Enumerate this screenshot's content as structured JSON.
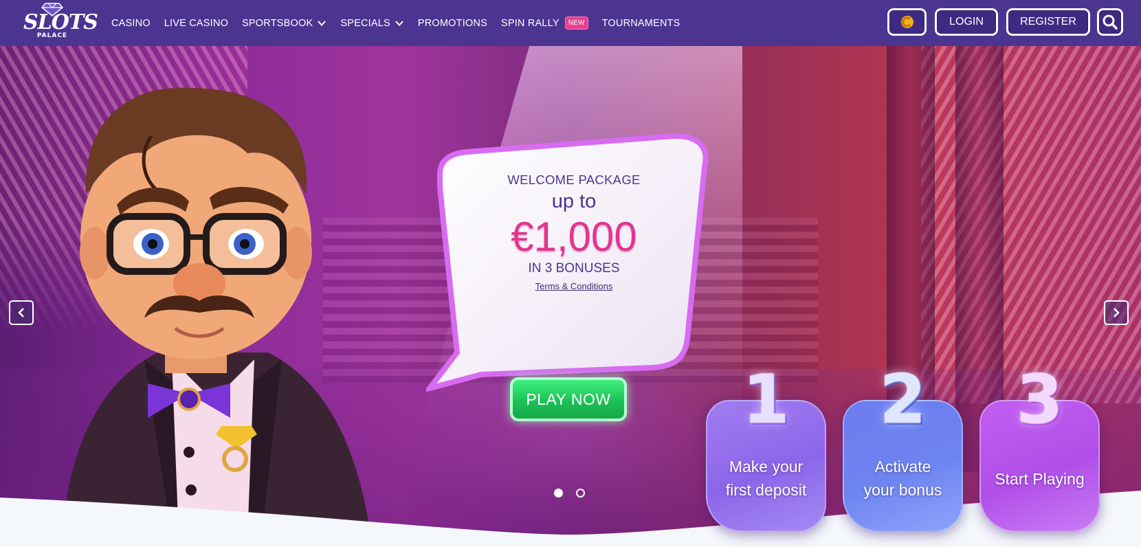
{
  "header": {
    "logo": {
      "brand": "SLOTS",
      "sub": "PALACE"
    },
    "nav": [
      {
        "label": "CASINO"
      },
      {
        "label": "LIVE CASINO"
      },
      {
        "label": "SPORTSBOOK"
      },
      {
        "label": "SPECIALS"
      },
      {
        "label": "PROMOTIONS"
      },
      {
        "label": "SPIN RALLY",
        "badge": "NEW"
      },
      {
        "label": "TOURNAMENTS"
      }
    ],
    "buttons": {
      "login": "LOGIN",
      "register": "REGISTER"
    },
    "icons": {
      "coin": "coin-icon",
      "search": "search-icon",
      "dropdown": "chevron-down-icon"
    }
  },
  "hero": {
    "promo": {
      "welcome": "WELCOME PACKAGE",
      "upto": "up to",
      "amount": "€1,000",
      "bonuses": "IN 3 BONUSES",
      "terms": "Terms & Conditions",
      "cta": "PLAY NOW"
    },
    "carousel": {
      "slides": 2,
      "active": 1,
      "icons": [
        "chevron-left-icon",
        "chevron-right-icon"
      ]
    },
    "steps": [
      {
        "number": "1",
        "line1": "Make your",
        "line2": "first deposit"
      },
      {
        "number": "2",
        "line1": "Activate",
        "line2": "your bonus"
      },
      {
        "number": "3",
        "line1": "Start Playing",
        "line2": ""
      }
    ]
  },
  "colors": {
    "header_bg": "#4b3591",
    "accent_pink": "#e6338f",
    "cta_green": "#1cc157",
    "new_badge": "#e83e8c"
  }
}
